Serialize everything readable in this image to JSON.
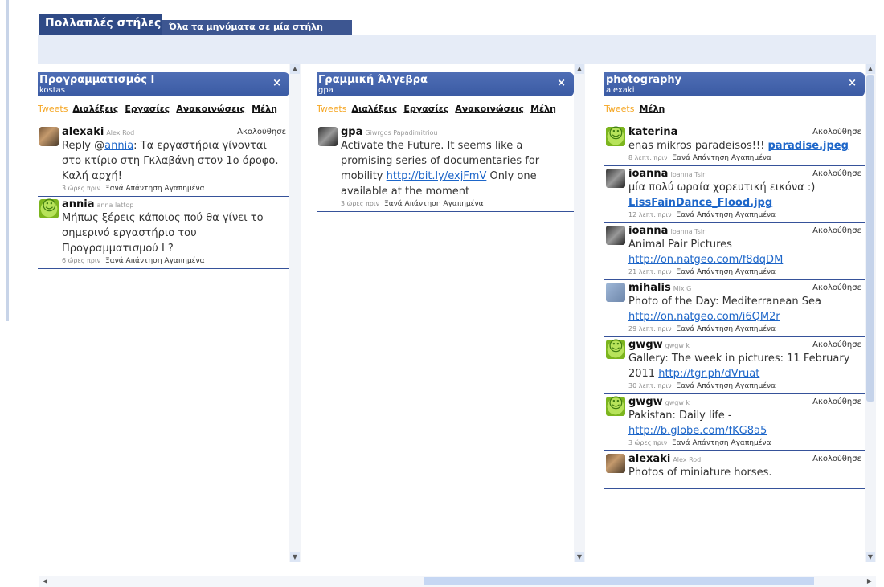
{
  "tabs": {
    "multiple_columns": "Πολλαπλές στήλες",
    "all_in_one": "Όλα τα μηνύματα σε μία στήλη"
  },
  "columns": [
    {
      "title": "Προγραμματισμός Ι",
      "user": "kostas",
      "close": "×",
      "nav": {
        "tweets": "Tweets",
        "links": [
          "Διαλέξεις",
          "Εργασίες",
          "Ανακοινώσεις",
          "Μέλη"
        ]
      },
      "tweets": [
        {
          "avatar": "photo",
          "user": "alexaki",
          "real": "Alex Rod",
          "follow": "Ακολούθησε",
          "text_before": "Reply @",
          "link": "annia",
          "text_after": ": Τα εργαστήρια γίνονται στο κτίριο στη Γκλαβάνη στον 1ο όροφο. Καλή αρχή!",
          "time": "3 ώρες πριν",
          "actions": "Ξανά Απάντηση Αγαπημένα"
        },
        {
          "avatar": "smile",
          "user": "annia",
          "real": "anna lattop",
          "follow": "",
          "text_before": "Μήπως ξέρεις κάποιος πού θα γίνει το σημερινό εργαστήριο του Προγραμματισμού Ι ?",
          "link": "",
          "text_after": "",
          "time": "6 ώρες πριν",
          "actions": "Ξανά Απάντηση Αγαπημένα"
        }
      ]
    },
    {
      "title": "Γραμμική Άλγεβρα",
      "user": "gpa",
      "close": "×",
      "nav": {
        "tweets": "Tweets",
        "links": [
          "Διαλέξεις",
          "Εργασίες",
          "Ανακοινώσεις",
          "Μέλη"
        ]
      },
      "tweets": [
        {
          "avatar": "gray",
          "user": "gpa",
          "real": "Giwrgos Papadimitriou",
          "follow": "",
          "text_before": "Activate the Future. It seems like a promising series of documentaries for mobility ",
          "link": "http://bit.ly/exjFmV",
          "text_after": " Only one available at the moment",
          "time": "3 ώρες πριν",
          "actions": "Ξανά Απάντηση Αγαπημένα"
        }
      ]
    },
    {
      "title": "photography",
      "user": "alexaki",
      "close": "×",
      "nav": {
        "tweets": "Tweets",
        "links": [
          "Μέλη"
        ]
      },
      "tweets": [
        {
          "avatar": "smile",
          "user": "katerina",
          "real": "",
          "follow": "Ακολούθησε",
          "text_before": "enas mikros paradeisos!!! ",
          "link": "paradise.jpeg",
          "link_bold": true,
          "text_after": "",
          "time": "8 λεπτ. πριν",
          "actions": "Ξανά Απάντηση Αγαπημένα"
        },
        {
          "avatar": "gray",
          "user": "ioanna",
          "real": "Ioanna Tsir",
          "follow": "Ακολούθησε",
          "text_before": "μία πολύ ωραία χορευτική εικόνα :) ",
          "link": "LissFainDance_Flood.jpg",
          "link_bold": true,
          "text_after": "",
          "time": "12 λεπτ. πριν",
          "actions": "Ξανά Απάντηση Αγαπημένα"
        },
        {
          "avatar": "gray",
          "user": "ioanna",
          "real": "Ioanna Tsir",
          "follow": "Ακολούθησε",
          "text_before": "Animal Pair Pictures ",
          "link": "http://on.natgeo.com/f8dqDM",
          "text_after": "",
          "time": "21 λεπτ. πριν",
          "actions": "Ξανά Απάντηση Αγαπημένα"
        },
        {
          "avatar": "sky",
          "user": "mihalis",
          "real": "Mix G",
          "follow": "Ακολούθησε",
          "text_before": "Photo of the Day: Mediterranean Sea ",
          "link": "http://on.natgeo.com/i6QM2r",
          "text_after": "",
          "time": "29 λεπτ. πριν",
          "actions": "Ξανά Απάντηση Αγαπημένα"
        },
        {
          "avatar": "smile",
          "user": "gwgw",
          "real": "gwgw k",
          "follow": "Ακολούθησε",
          "text_before": "Gallery: The week in pictures: 11 February 2011 ",
          "link": "http://tgr.ph/dVruat",
          "text_after": "",
          "time": "30 λεπτ. πριν",
          "actions": "Ξανά Απάντηση Αγαπημένα"
        },
        {
          "avatar": "smile",
          "user": "gwgw",
          "real": "gwgw k",
          "follow": "Ακολούθησε",
          "text_before": "Pakistan: Daily life - ",
          "link": "http://b.globe.com/fKG8a5",
          "text_after": "",
          "time": "3 ώρες πριν",
          "actions": "Ξανά Απάντηση Αγαπημένα"
        },
        {
          "avatar": "photo",
          "user": "alexaki",
          "real": "Alex Rod",
          "follow": "Ακολούθησε",
          "text_before": "Photos of miniature horses.",
          "link": "",
          "text_after": "",
          "time": "",
          "actions": ""
        }
      ]
    }
  ]
}
